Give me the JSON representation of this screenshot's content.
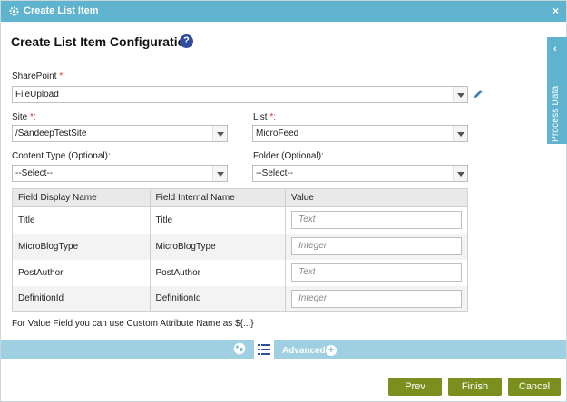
{
  "window": {
    "title": "Create List Item",
    "close_glyph": "×"
  },
  "page": {
    "heading": "Create List Item Configuration",
    "help_glyph": "?"
  },
  "sharepoint": {
    "label": "SharePoint",
    "required_mark": "*:",
    "value": "FileUpload"
  },
  "site": {
    "label": "Site",
    "required_mark": "*:",
    "value": "/SandeepTestSite"
  },
  "list": {
    "label": "List",
    "required_mark": "*:",
    "value": "MicroFeed"
  },
  "content_type": {
    "label": "Content Type (Optional):",
    "value": "--Select--"
  },
  "folder": {
    "label": "Folder (Optional):",
    "value": "--Select--"
  },
  "side_panel": {
    "label": "Process Data",
    "chevron": "‹"
  },
  "table": {
    "headers": [
      "Field Display Name",
      "Field Internal Name",
      "Value"
    ],
    "rows": [
      {
        "display": "Title",
        "internal": "Title",
        "placeholder": "Text"
      },
      {
        "display": "MicroBlogType",
        "internal": "MicroBlogType",
        "placeholder": "Integer"
      },
      {
        "display": "PostAuthor",
        "internal": "PostAuthor",
        "placeholder": "Text"
      },
      {
        "display": "DefinitionId",
        "internal": "DefinitionId",
        "placeholder": "Integer"
      }
    ]
  },
  "note": "For Value Field you can use Custom Attribute Name as ${...}",
  "advanced": {
    "label": "Advanced",
    "plus_glyph": "+"
  },
  "buttons": {
    "prev": "Prev",
    "finish": "Finish",
    "cancel": "Cancel"
  },
  "colors": {
    "accent": "#5fb3ce",
    "advanced_bar": "#9fd0e2",
    "button": "#7a8f1e",
    "help_icon": "#2f4f9e",
    "required": "#e03030"
  },
  "icons": [
    "gear-icon",
    "close-icon",
    "help-icon",
    "dropdown-arrow-icon",
    "pencil-icon",
    "chevron-left-icon",
    "globe-icon",
    "list-icon",
    "plus-icon"
  ]
}
